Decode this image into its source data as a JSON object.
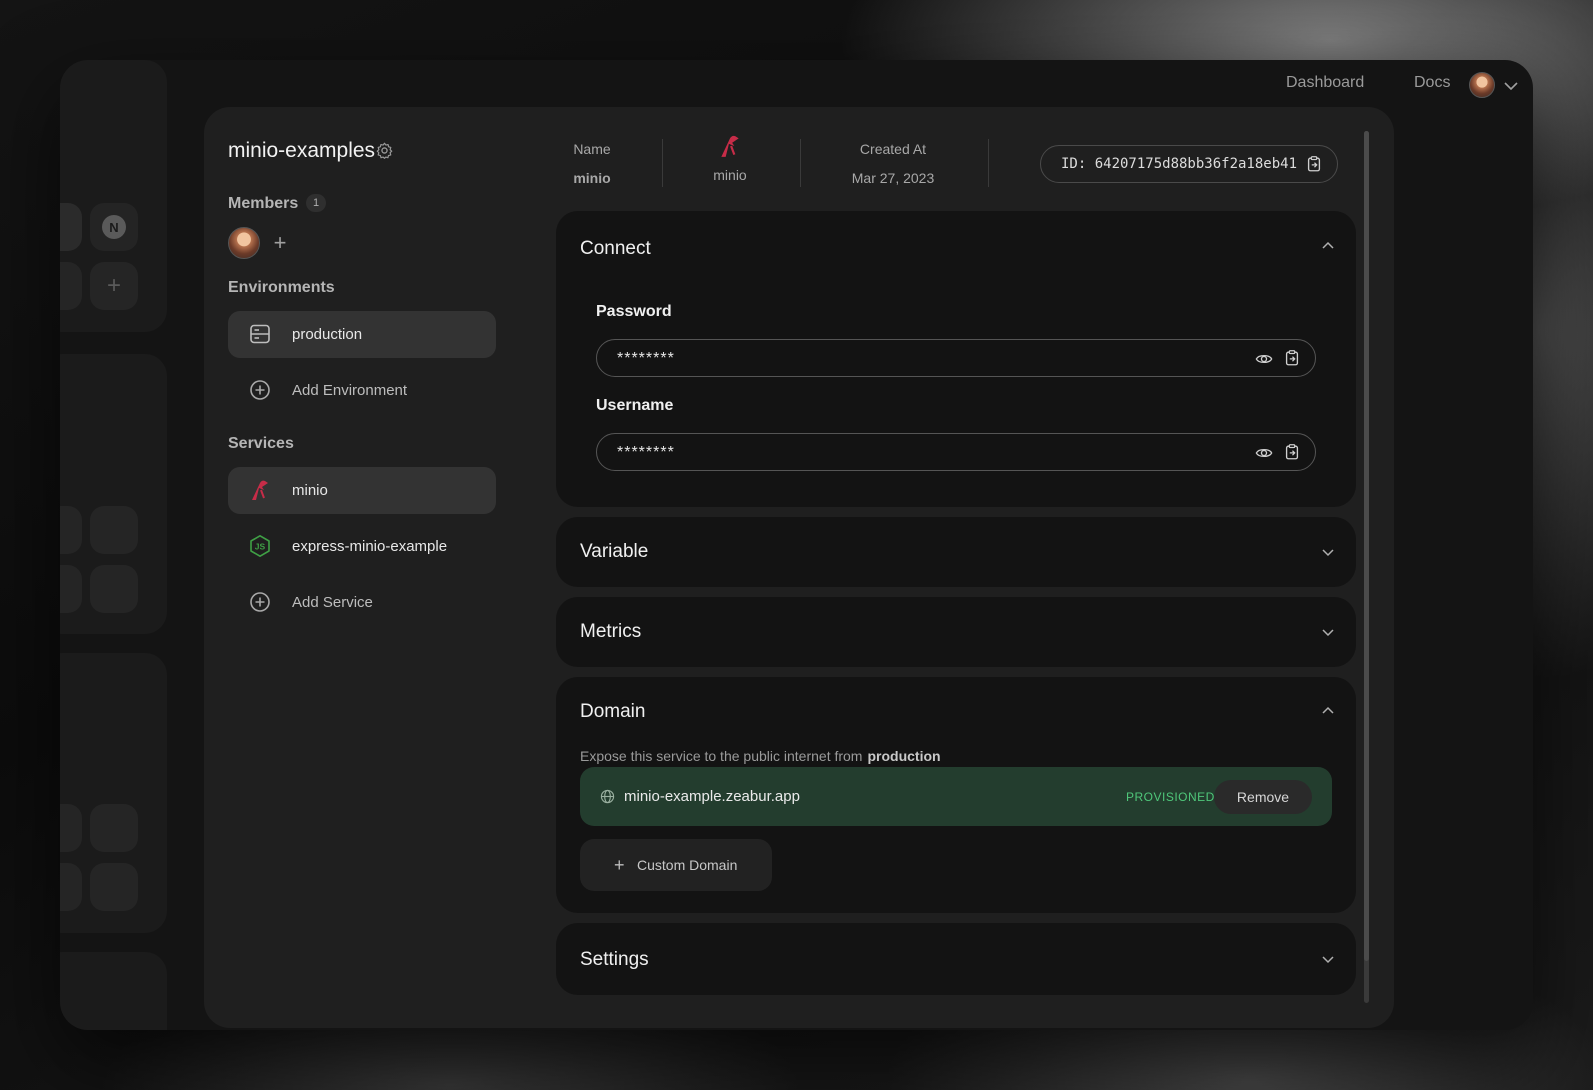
{
  "nav": {
    "dashboard": "Dashboard",
    "docs": "Docs"
  },
  "project": {
    "name": "minio-examples"
  },
  "members": {
    "label": "Members",
    "count": "1"
  },
  "environments": {
    "label": "Environments",
    "items": [
      {
        "name": "production",
        "icon": "server-icon"
      }
    ],
    "add_label": "Add Environment"
  },
  "services": {
    "label": "Services",
    "items": [
      {
        "name": "minio",
        "icon": "minio-icon"
      },
      {
        "name": "express-minio-example",
        "icon": "nodejs-icon"
      }
    ],
    "add_label": "Add Service"
  },
  "service_header": {
    "name_label": "Name",
    "name_value": "minio",
    "type_value": "minio",
    "created_label": "Created At",
    "created_value": "Mar 27, 2023",
    "id": "ID: 64207175d88bb36f2a18eb41"
  },
  "connect": {
    "title": "Connect",
    "password_label": "Password",
    "password_value": "********",
    "username_label": "Username",
    "username_value": "********"
  },
  "variable": {
    "title": "Variable"
  },
  "metrics": {
    "title": "Metrics"
  },
  "domain": {
    "title": "Domain",
    "description": "Expose this service to the public internet from",
    "environment": "production",
    "hostname": "minio-example.zeabur.app",
    "status": "PROVISIONED",
    "remove_label": "Remove",
    "custom_label": "Custom Domain"
  },
  "settings": {
    "title": "Settings"
  },
  "colors": {
    "accent_minio": "#c72c48",
    "accent_node": "#3fa045",
    "provisioned": "#4fc77a",
    "domain_row_bg": "#233d2e"
  }
}
